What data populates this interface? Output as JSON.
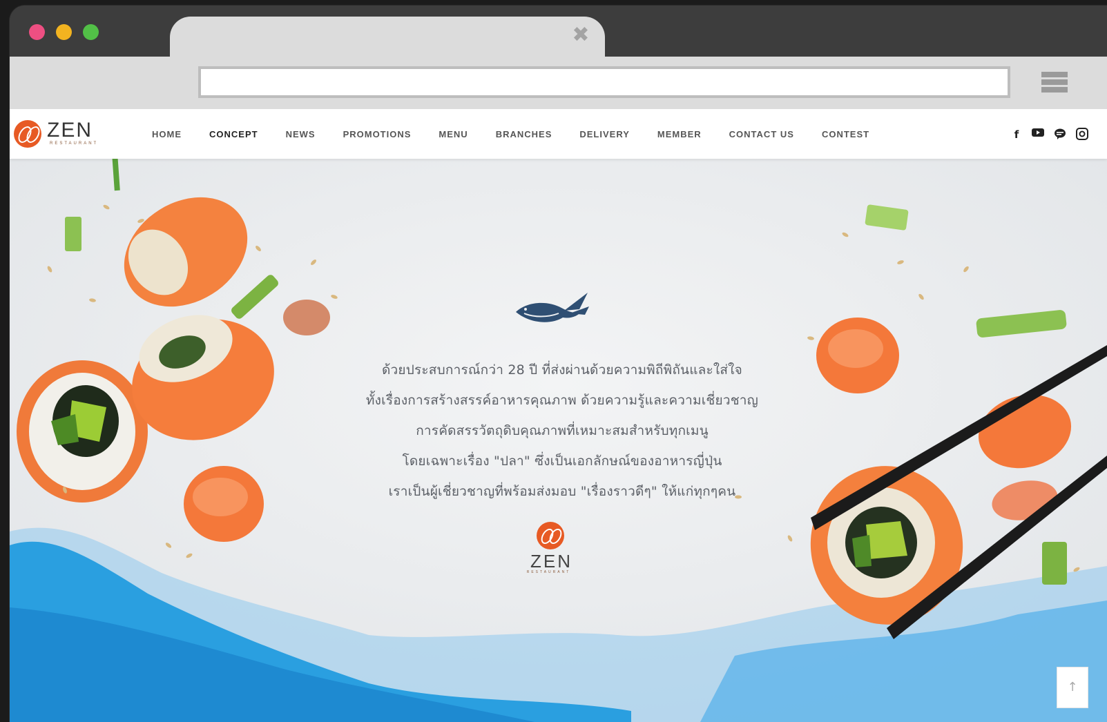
{
  "browser": {
    "address_value": "",
    "address_placeholder": ""
  },
  "site": {
    "logo_text": "ZEN",
    "logo_sub": "RESTAURANT"
  },
  "nav": {
    "items": [
      {
        "label": "HOME"
      },
      {
        "label": "CONCEPT"
      },
      {
        "label": "NEWS"
      },
      {
        "label": "PROMOTIONS"
      },
      {
        "label": "MENU"
      },
      {
        "label": "BRANCHES"
      },
      {
        "label": "DELIVERY"
      },
      {
        "label": "MEMBER"
      },
      {
        "label": "CONTACT US"
      },
      {
        "label": "CONTEST"
      }
    ],
    "active": "CONCEPT"
  },
  "social": {
    "facebook_glyph": "f"
  },
  "hero": {
    "lines": [
      "ด้วยประสบการณ์กว่า 28 ปี ที่ส่งผ่านด้วยความพิถีพิถันและใส่ใจ",
      "ทั้งเรื่องการสร้างสรรค์อาหารคุณภาพ ด้วยความรู้และความเชี่ยวชาญ",
      "การคัดสรรวัตถุดิบคุณภาพที่เหมาะสมสำหรับทุกเมนู",
      "โดยเฉพาะเรื่อง \"ปลา\" ซึ่งเป็นเอกลักษณ์ของอาหารญี่ปุ่น",
      "เราเป็นผู้เชี่ยวชาญที่พร้อมส่งมอบ \"เรื่องราวดีๆ\" ให้แก่ทุกๆคน"
    ],
    "logo_text": "ZEN",
    "logo_sub": "RESTAURANT"
  },
  "scroll_top": {
    "glyph": "↑"
  },
  "colors": {
    "accent": "#e75a24",
    "water": "#2a9fe0",
    "chrome": "#3d3d3d"
  }
}
